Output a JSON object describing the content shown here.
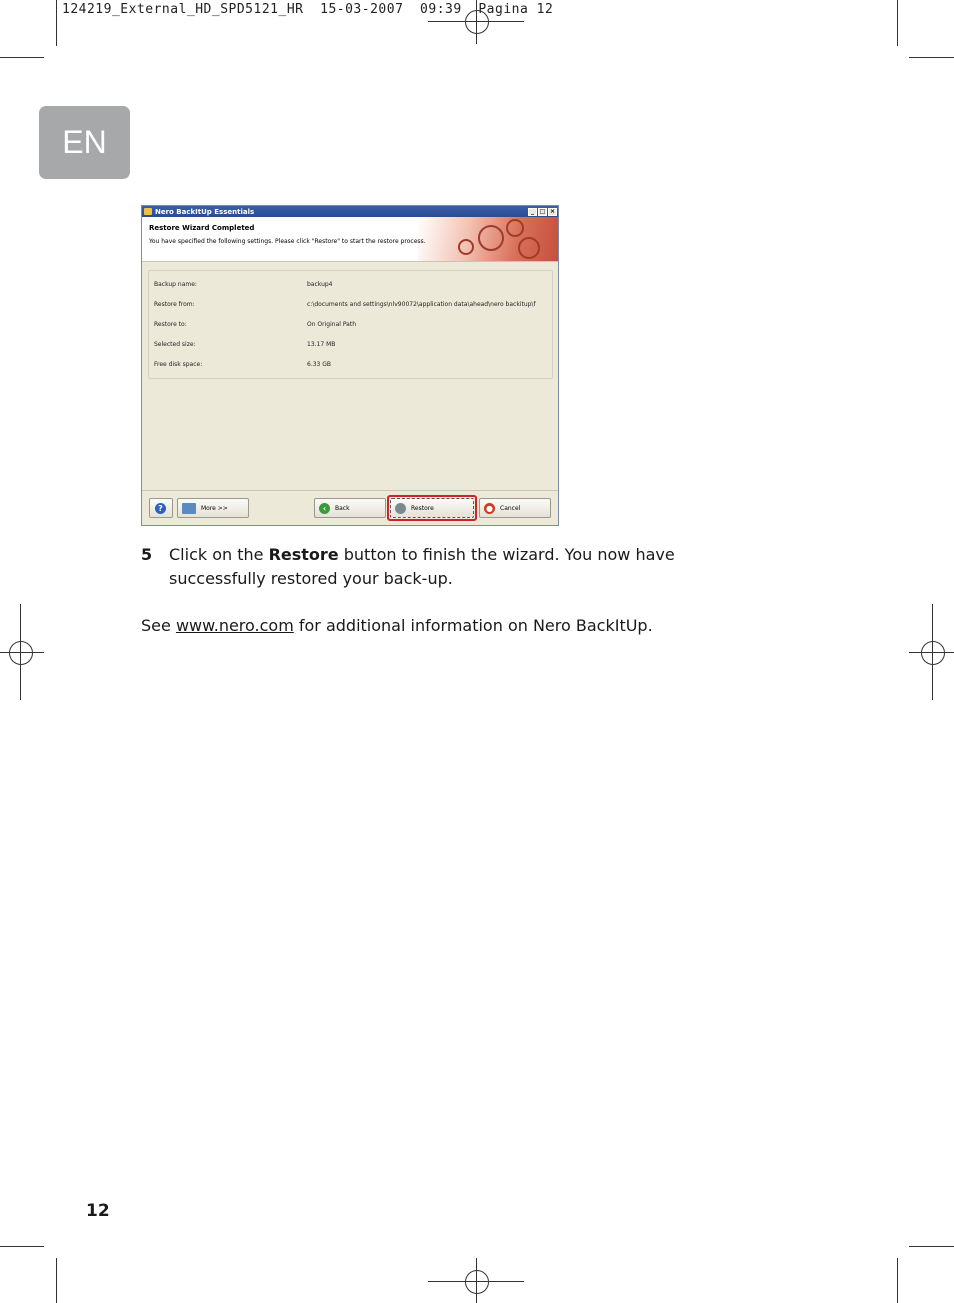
{
  "slug": "124219_External_HD_SPD5121_HR  15-03-2007  09:39  Pagina 12",
  "language_tab": "EN",
  "window": {
    "title": "Nero BackItUp Essentials",
    "header_title": "Restore Wizard Completed",
    "header_subtitle": "You have specified the following settings. Please click \"Restore\" to start the restore process.",
    "settings": [
      {
        "label": "Backup name:",
        "value": "backup4"
      },
      {
        "label": "Restore from:",
        "value": "c:\\documents and settings\\nlv90072\\application data\\ahead\\nero backitup\\f"
      },
      {
        "label": "Restore to:",
        "value": "On Original Path"
      },
      {
        "label": "Selected size:",
        "value": "13.17 MB"
      },
      {
        "label": "Free disk space:",
        "value": "6.33 GB"
      }
    ],
    "buttons": {
      "more": "More >>",
      "back": "Back",
      "restore": "Restore",
      "cancel": "Cancel"
    }
  },
  "step": {
    "number": "5",
    "text_before": "Click on the ",
    "bold": "Restore",
    "text_after": " button to finish the wizard. You now have successfully restored your back-up."
  },
  "see": {
    "before": "See ",
    "link": "www.nero.com",
    "after": " for additional information on Nero BackItUp."
  },
  "page_number": "12"
}
